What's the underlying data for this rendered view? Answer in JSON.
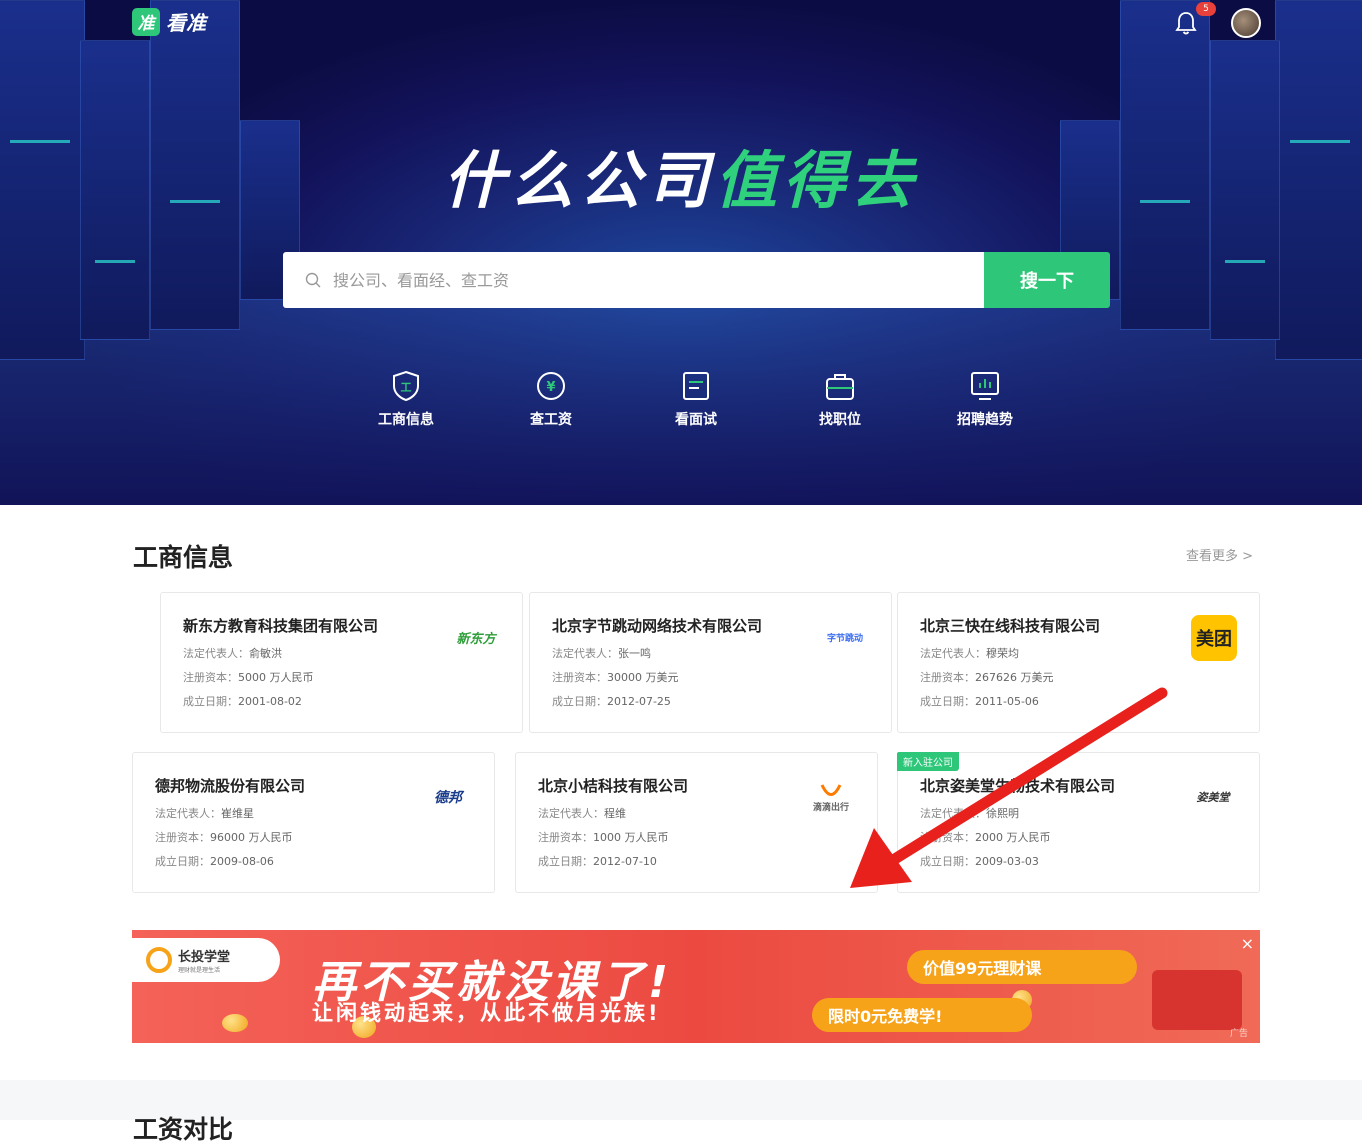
{
  "header": {
    "logo_badge": "准",
    "logo_text": "看准",
    "notification_count": "5"
  },
  "hero": {
    "slogan_white": "什么公司",
    "slogan_green": "值得去",
    "search_placeholder": "搜公司、看面经、查工资",
    "search_button": "搜一下"
  },
  "nav": [
    {
      "label": "工商信息",
      "icon": "shield-icon"
    },
    {
      "label": "查工资",
      "icon": "yen-icon"
    },
    {
      "label": "看面试",
      "icon": "document-icon"
    },
    {
      "label": "找职位",
      "icon": "briefcase-icon"
    },
    {
      "label": "招聘趋势",
      "icon": "chart-monitor-icon"
    }
  ],
  "section": {
    "title": "工商信息",
    "more": "查看更多 >"
  },
  "labels": {
    "rep": "法定代表人：",
    "capital": "注册资本：",
    "date": "成立日期："
  },
  "companies": [
    {
      "name": "新东方教育科技集团有限公司",
      "rep": "俞敏洪",
      "capital": "5000 万人民币",
      "date": "2001-08-02",
      "logo": "新东方",
      "logo_color": "#2e9e3a"
    },
    {
      "name": "北京字节跳动网络技术有限公司",
      "rep": "张一鸣",
      "capital": "30000 万美元",
      "date": "2012-07-25",
      "logo": "字节跳动",
      "logo_color": "#3c6ef0"
    },
    {
      "name": "北京三快在线科技有限公司",
      "rep": "穆荣均",
      "capital": "267626 万美元",
      "date": "2011-05-06",
      "logo": "美团",
      "logo_color": "#ffc300"
    },
    {
      "name": "德邦物流股份有限公司",
      "rep": "崔维星",
      "capital": "96000 万人民币",
      "date": "2009-08-06",
      "logo": "德邦",
      "logo_color": "#1a3c8c"
    },
    {
      "name": "北京小桔科技有限公司",
      "rep": "程维",
      "capital": "1000 万人民币",
      "date": "2012-07-10",
      "logo": "滴滴出行",
      "logo_color": "#ff7a00"
    },
    {
      "name": "北京姿美堂生物技术有限公司",
      "rep": "徐熙明",
      "capital": "2000 万人民币",
      "date": "2009-03-03",
      "logo": "姿美堂",
      "logo_color": "#333333",
      "tag": "新入驻公司"
    }
  ],
  "ad": {
    "brand": "长投学堂",
    "brand_sub": "理财就是理生活",
    "headline": "再不买就没课了!",
    "subline": "让闲钱动起来，从此不做月光族!",
    "pill1": "价值99元理财课",
    "pill2": "限时0元免费学!",
    "close": "×",
    "mark": "广告"
  },
  "footer": {
    "next_title": "工资对比"
  },
  "colors": {
    "brand_green": "#2ec77a",
    "arrow_red": "#e8211c"
  }
}
